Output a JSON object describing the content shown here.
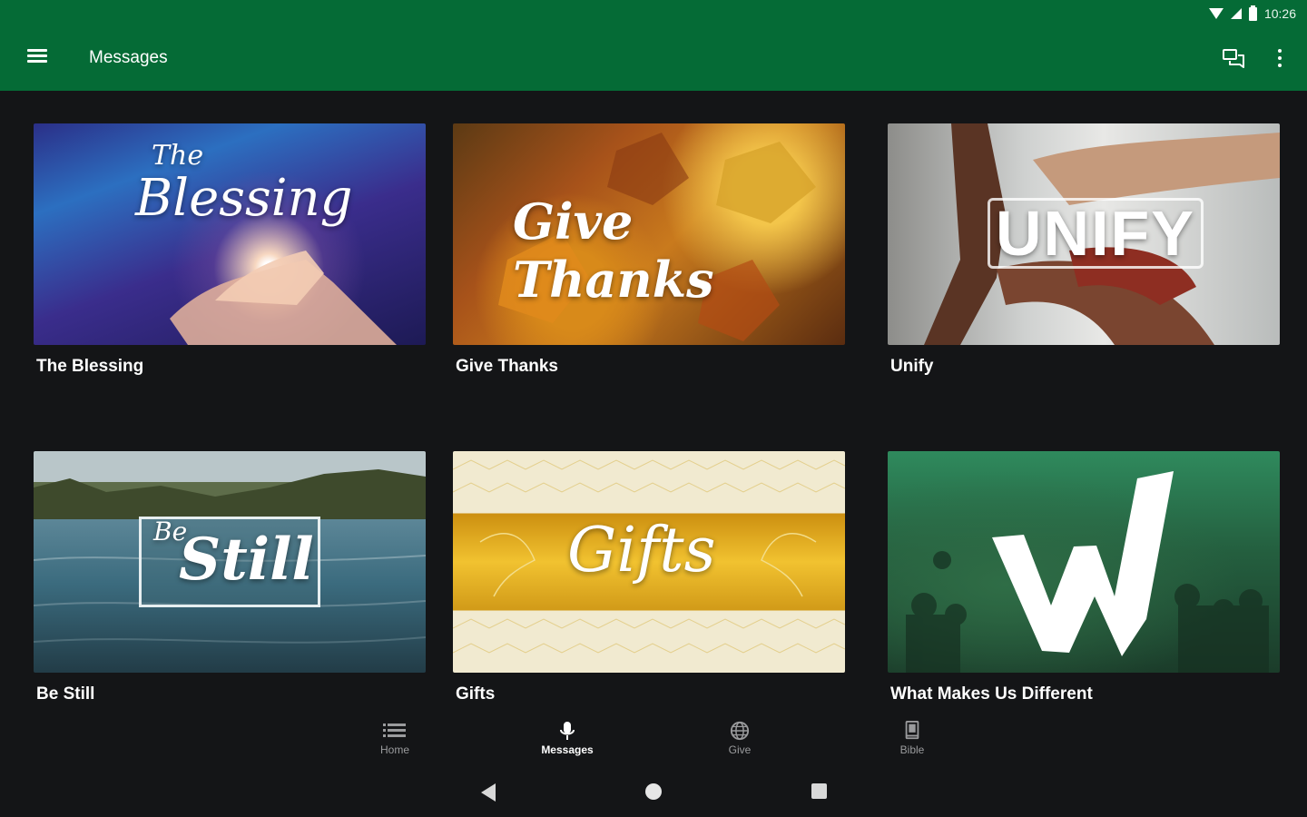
{
  "status_bar": {
    "time": "10:26"
  },
  "app_bar": {
    "title": "Messages",
    "background": "#056b36"
  },
  "messages": [
    {
      "title": "The Blessing",
      "art_text": [
        "The",
        "Blessing"
      ]
    },
    {
      "title": "Give Thanks",
      "art_text": [
        "Give Thanks"
      ]
    },
    {
      "title": "Unify",
      "art_text": [
        "UNIFY"
      ]
    },
    {
      "title": "Be Still",
      "art_text": [
        "Be",
        "Still"
      ]
    },
    {
      "title": "Gifts",
      "art_text": [
        "Gifts"
      ]
    },
    {
      "title": "What Makes Us Different",
      "art_text": [
        "W"
      ]
    }
  ],
  "bottom_nav": [
    {
      "label": "Home",
      "icon": "list-icon",
      "active": false
    },
    {
      "label": "Messages",
      "icon": "microphone-icon",
      "active": true
    },
    {
      "label": "Give",
      "icon": "globe-icon",
      "active": false
    },
    {
      "label": "Bible",
      "icon": "book-icon",
      "active": false
    }
  ],
  "system_nav": {
    "buttons": [
      "back-icon",
      "home-icon",
      "recents-icon"
    ]
  }
}
